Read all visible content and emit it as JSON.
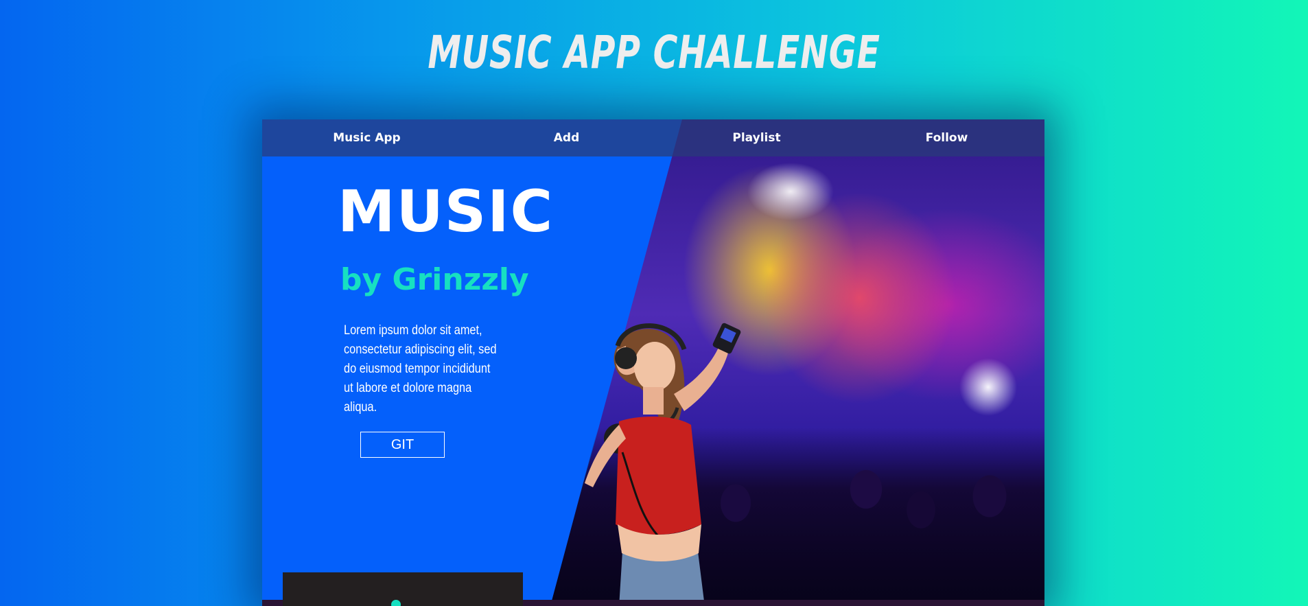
{
  "page": {
    "heading": "MUSIC APP CHALLENGE"
  },
  "nav": {
    "items": [
      {
        "label": "Music App"
      },
      {
        "label": "Add"
      },
      {
        "label": "Playlist"
      },
      {
        "label": "Follow"
      }
    ]
  },
  "hero": {
    "title": "MUSIC",
    "subtitle": "by Grinzzly",
    "body": "Lorem ipsum dolor sit amet, consectetur adipiscing elit, sed do eiusmod tempor incididunt ut labore et dolore magna aliqua.",
    "button_label": "GIT"
  },
  "colors": {
    "accent": "#17e0c1",
    "hero_bg": "#0460fb",
    "nav_bg": "#283c78",
    "player_bg": "#231f20"
  }
}
